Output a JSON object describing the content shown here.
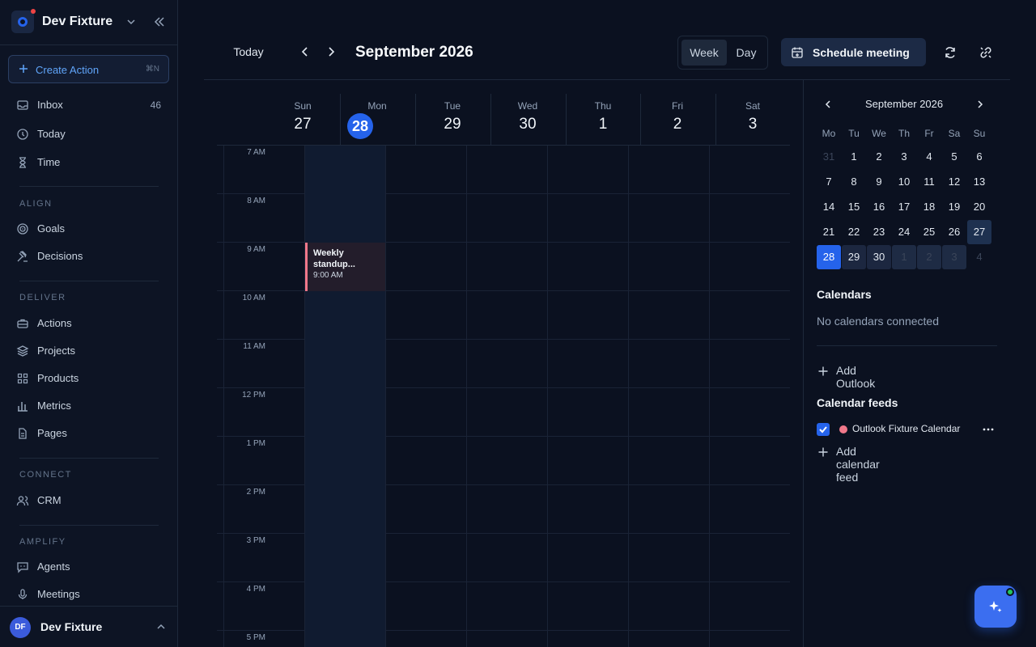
{
  "workspace": {
    "name": "Dev Fixture"
  },
  "sidebar": {
    "create_action": {
      "label": "Create Action",
      "shortcut": "⌘N"
    },
    "top_items": [
      {
        "label": "Inbox",
        "icon": "inbox-icon",
        "count": "46"
      },
      {
        "label": "Today",
        "icon": "clock-icon"
      },
      {
        "label": "Time",
        "icon": "hourglass-icon"
      }
    ],
    "sections": [
      {
        "label": "ALIGN",
        "items": [
          {
            "label": "Goals",
            "icon": "target-icon"
          },
          {
            "label": "Decisions",
            "icon": "gavel-icon"
          }
        ]
      },
      {
        "label": "DELIVER",
        "items": [
          {
            "label": "Actions",
            "icon": "briefcase-icon"
          },
          {
            "label": "Projects",
            "icon": "layers-icon"
          },
          {
            "label": "Products",
            "icon": "grid-icon"
          },
          {
            "label": "Metrics",
            "icon": "bar-chart-icon"
          },
          {
            "label": "Pages",
            "icon": "document-icon"
          }
        ]
      },
      {
        "label": "CONNECT",
        "items": [
          {
            "label": "CRM",
            "icon": "users-icon"
          }
        ]
      },
      {
        "label": "AMPLIFY",
        "items": [
          {
            "label": "Agents",
            "icon": "chat-bot-icon"
          },
          {
            "label": "Meetings",
            "icon": "microphone-icon"
          }
        ]
      }
    ],
    "user": {
      "initials": "DF",
      "name": "Dev Fixture"
    }
  },
  "toolbar": {
    "today_label": "Today",
    "month_title": "September 2026",
    "views": [
      "Week",
      "Day"
    ],
    "active_view": "Week",
    "schedule_label": "Schedule meeting"
  },
  "week": {
    "days": [
      {
        "dow": "Sun",
        "num": "27"
      },
      {
        "dow": "Mon",
        "num": "28",
        "today": true
      },
      {
        "dow": "Tue",
        "num": "29"
      },
      {
        "dow": "Wed",
        "num": "30"
      },
      {
        "dow": "Thu",
        "num": "1"
      },
      {
        "dow": "Fri",
        "num": "2"
      },
      {
        "dow": "Sat",
        "num": "3"
      }
    ],
    "hours": [
      "7 AM",
      "8 AM",
      "9 AM",
      "10 AM",
      "11 AM",
      "12 PM",
      "1 PM",
      "2 PM",
      "3 PM",
      "4 PM",
      "5 PM"
    ],
    "event": {
      "title": "Weekly standup...",
      "time": "9:00 AM",
      "color": "#f0788a"
    }
  },
  "mini_calendar": {
    "title": "September 2026",
    "dow": [
      "Mo",
      "Tu",
      "We",
      "Th",
      "Fr",
      "Sa",
      "Su"
    ],
    "weeks": [
      [
        "31",
        "1",
        "2",
        "3",
        "4",
        "5",
        "6"
      ],
      [
        "7",
        "8",
        "9",
        "10",
        "11",
        "12",
        "13"
      ],
      [
        "14",
        "15",
        "16",
        "17",
        "18",
        "19",
        "20"
      ],
      [
        "21",
        "22",
        "23",
        "24",
        "25",
        "26",
        "27"
      ],
      [
        "28",
        "29",
        "30",
        "1",
        "2",
        "3",
        "4"
      ]
    ]
  },
  "calendars": {
    "heading": "Calendars",
    "empty_text": "No calendars connected",
    "add_outlook": "Add Outlook",
    "feeds_heading": "Calendar feeds",
    "feeds": [
      {
        "name": "Outlook Fixture Calendar",
        "color": "#f0788a",
        "checked": true
      }
    ],
    "add_feed": "Add calendar feed"
  },
  "colors": {
    "accent": "#2563eb",
    "background": "#0b1120",
    "event": "#f0788a"
  }
}
